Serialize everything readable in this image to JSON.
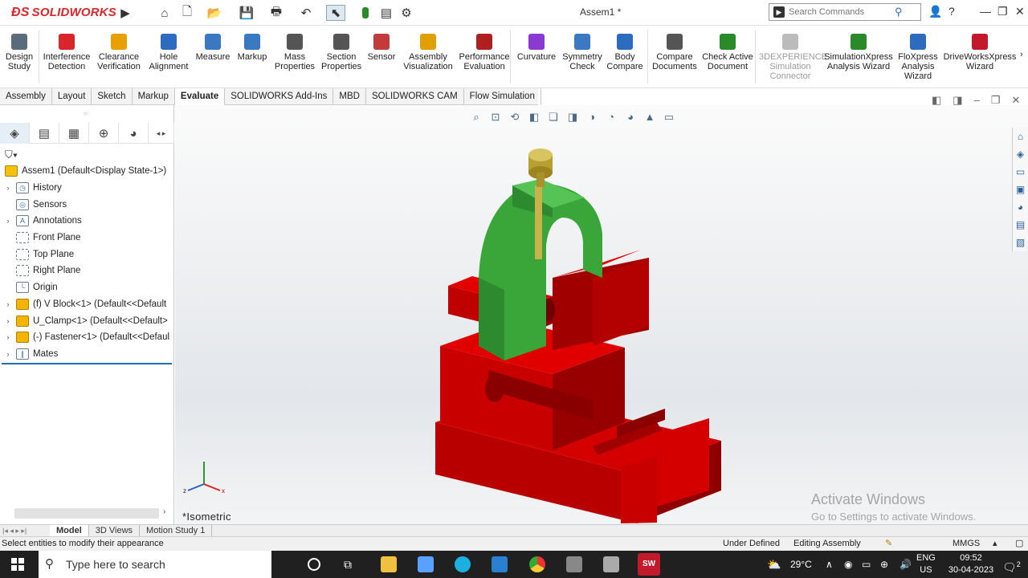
{
  "app": {
    "logo": "SOLIDWORKS",
    "document_title": "Assem1 *"
  },
  "search": {
    "placeholder": "Search Commands"
  },
  "ribbon": [
    {
      "label": "Design Study",
      "color": "#5a6b7d"
    },
    {
      "label": "Interference Detection",
      "color": "#d8262a"
    },
    {
      "label": "Clearance Verification",
      "color": "#e8a000"
    },
    {
      "label": "Hole Alignment",
      "color": "#2d6bbf"
    },
    {
      "label": "Measure",
      "color": "#3a78c2"
    },
    {
      "label": "Markup",
      "color": "#3a78c2"
    },
    {
      "label": "Mass Properties",
      "color": "#555555"
    },
    {
      "label": "Section Properties",
      "color": "#555555"
    },
    {
      "label": "Sensor",
      "color": "#c23a3a"
    },
    {
      "label": "Assembly Visualization",
      "color": "#e0a000"
    },
    {
      "label": "Performance Evaluation",
      "color": "#b02020"
    },
    {
      "label": "Curvature",
      "color": "#8a3ad0"
    },
    {
      "label": "Symmetry Check",
      "color": "#3a78c2"
    },
    {
      "label": "Body Compare",
      "color": "#2d6bbf"
    },
    {
      "label": "Compare Documents",
      "color": "#555555"
    },
    {
      "label": "Check Active Document",
      "color": "#2a8a2a"
    },
    {
      "label": "3DEXPERIENCE Simulation Connector",
      "color": "#bbbbbb"
    },
    {
      "label": "SimulationXpress Analysis Wizard",
      "color": "#2a8a2a"
    },
    {
      "label": "FloXpress Analysis Wizard",
      "color": "#2d6bbf"
    },
    {
      "label": "DriveWorksXpress Wizard",
      "color": "#c21a2a"
    }
  ],
  "command_tabs": [
    "Assembly",
    "Layout",
    "Sketch",
    "Markup",
    "Evaluate",
    "SOLIDWORKS Add-Ins",
    "MBD",
    "SOLIDWORKS CAM",
    "Flow Simulation"
  ],
  "active_command_tab": "Evaluate",
  "tree": {
    "root": "Assem1  (Default<Display State-1>)",
    "items": [
      {
        "label": "History",
        "expandable": true
      },
      {
        "label": "Sensors",
        "expandable": false
      },
      {
        "label": "Annotations",
        "expandable": true
      },
      {
        "label": "Front Plane",
        "expandable": false
      },
      {
        "label": "Top Plane",
        "expandable": false
      },
      {
        "label": "Right Plane",
        "expandable": false
      },
      {
        "label": "Origin",
        "expandable": false
      },
      {
        "label": "(f) V Block<1> (Default<<Default",
        "expandable": true
      },
      {
        "label": "U_Clamp<1> (Default<<Default>",
        "expandable": true
      },
      {
        "label": "(-) Fastener<1> (Default<<Defaul",
        "expandable": true
      },
      {
        "label": "Mates",
        "expandable": true
      }
    ]
  },
  "viewport": {
    "view_name": "*Isometric",
    "watermark_title": "Activate Windows",
    "watermark_sub": "Go to Settings to activate Windows.",
    "colors": {
      "vblock": "#d40000",
      "clamp": "#3aa63a",
      "fastener": "#c9b24a"
    }
  },
  "bottom_tabs": [
    "Model",
    "3D Views",
    "Motion Study 1"
  ],
  "active_bottom_tab": "Model",
  "status": {
    "hint": "Select entities to modify their appearance",
    "state": "Under Defined",
    "mode": "Editing Assembly",
    "units": "MMGS"
  },
  "taskbar": {
    "search_placeholder": "Type here to search",
    "temperature": "29°C",
    "language": "ENG",
    "region": "US",
    "time": "09:52",
    "date": "30-04-2023",
    "notifications": "2"
  }
}
